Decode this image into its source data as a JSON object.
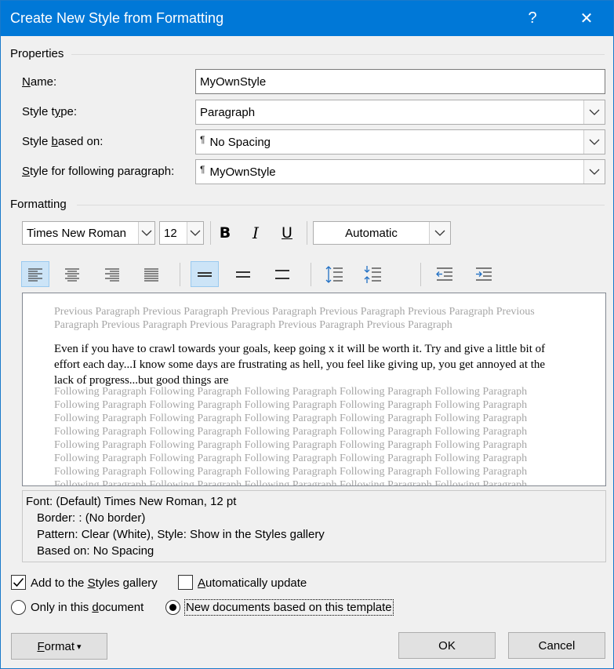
{
  "window": {
    "title": "Create New Style from Formatting",
    "help": "?",
    "close": "✕"
  },
  "properties": {
    "group_label": "Properties",
    "name": {
      "label_a": "N",
      "label_b": "ame:",
      "value": "MyOwnStyle"
    },
    "style_type": {
      "label_a": "Style t",
      "label_b": "y",
      "label_c": "pe:",
      "value": "Paragraph"
    },
    "based_on": {
      "label_a": "Style ",
      "label_b": "b",
      "label_c": "ased on:",
      "mark": "¶",
      "value": "No Spacing"
    },
    "following": {
      "label_a": "S",
      "label_b": "tyle for following paragraph:",
      "mark": "¶",
      "value": "MyOwnStyle"
    }
  },
  "formatting": {
    "group_label": "Formatting",
    "font": "Times New Roman",
    "size": "12",
    "bold": "B",
    "italic": "I",
    "underline": "U",
    "color": "Automatic"
  },
  "preview": {
    "previous": "Previous Paragraph Previous Paragraph Previous Paragraph Previous Paragraph Previous Paragraph Previous Paragraph Previous Paragraph Previous Paragraph Previous Paragraph Previous Paragraph",
    "sample": "Even if you have to crawl towards your goals, keep going x it will be worth it. Try and give a little bit of effort each day...I know some days are frustrating as hell, you feel like giving up, you get annoyed at the lack of progress...but good things are",
    "following": "Following Paragraph Following Paragraph Following Paragraph Following Paragraph Following Paragraph Following Paragraph Following Paragraph Following Paragraph Following Paragraph Following Paragraph Following Paragraph Following Paragraph Following Paragraph Following Paragraph Following Paragraph Following Paragraph Following Paragraph Following Paragraph Following Paragraph Following Paragraph Following Paragraph Following Paragraph Following Paragraph Following Paragraph Following Paragraph Following Paragraph Following Paragraph Following Paragraph Following Paragraph Following Paragraph Following Paragraph Following Paragraph Following Paragraph Following Paragraph Following Paragraph Following Paragraph Following Paragraph Following Paragraph Following Paragraph Following Paragraph Following Paragraph Following Paragraph Following Paragraph Following Paragraph"
  },
  "description": {
    "line1": "Font: (Default) Times New Roman, 12 pt",
    "line2": "Border: : (No border)",
    "line3": "Pattern: Clear (White), Style: Show in the Styles gallery",
    "line4": "Based on: No Spacing"
  },
  "options": {
    "add_gallery": {
      "a": "Add to the ",
      "b": "S",
      "c": "tyles gallery",
      "checked": true
    },
    "auto_update": {
      "a": "A",
      "b": "utomatically update",
      "checked": false
    },
    "only_doc": {
      "a": "Only in this ",
      "b": "d",
      "c": "ocument",
      "selected": false
    },
    "new_docs": {
      "label": "New documents based on this template",
      "selected": true
    }
  },
  "buttons": {
    "format_a": "F",
    "format_b": "ormat",
    "format_arrow": "▾",
    "ok": "OK",
    "cancel": "Cancel"
  }
}
